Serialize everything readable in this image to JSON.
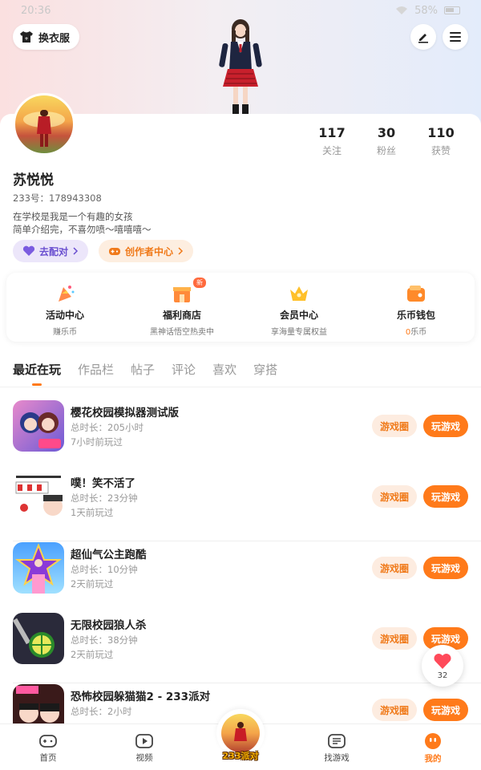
{
  "status_bar": {
    "time": "20:36",
    "battery": "58%"
  },
  "header": {
    "outfit_label": "换衣服"
  },
  "profile": {
    "name": "苏悦悦",
    "uid": "233号：178943308",
    "bio_line1": "在学校是我是一个有趣的女孩",
    "bio_line2": "简单介绍完，不喜勿喷～嘻嘻嘻～",
    "stats": [
      {
        "num": "117",
        "label": "关注"
      },
      {
        "num": "30",
        "label": "粉丝"
      },
      {
        "num": "110",
        "label": "获赞"
      }
    ],
    "pair_label": "去配对",
    "creator_label": "创作者中心"
  },
  "services": [
    {
      "title": "活动中心",
      "sub": "赚乐币",
      "icon": "party-icon"
    },
    {
      "title": "福利商店",
      "sub": "黑神话悟空热卖中",
      "icon": "shop-icon",
      "badge": "new"
    },
    {
      "title": "会员中心",
      "sub": "享海量专属权益",
      "icon": "crown-icon"
    },
    {
      "title": "乐币钱包",
      "sub_zero": "0",
      "sub": "乐币",
      "icon": "wallet-icon"
    }
  ],
  "tabs": [
    "最近在玩",
    "作品栏",
    "帖子",
    "评论",
    "喜欢",
    "穿搭"
  ],
  "games": [
    {
      "title": "樱花校园模拟器测试版",
      "duration": "总时长：205小时",
      "last": "7小时前玩过"
    },
    {
      "title": "噗！笑不活了",
      "duration": "总时长：23分钟",
      "last": "1天前玩过"
    },
    {
      "title": "超仙气公主跑酷",
      "duration": "总时长：10分钟",
      "last": "2天前玩过"
    },
    {
      "title": "无限校园狼人杀",
      "duration": "总时长：38分钟",
      "last": "2天前玩过"
    },
    {
      "title": "恐怖校园躲猫猫2 - 233派对",
      "duration": "总时长：2小时",
      "last": ""
    }
  ],
  "buttons": {
    "circle": "游戏圈",
    "play": "玩游戏"
  },
  "like_fab": {
    "count": "32"
  },
  "nav": {
    "home": "首页",
    "video": "视频",
    "center": "233派对",
    "find": "找游戏",
    "me": "我的"
  },
  "colors": {
    "accent": "#ff7a1a",
    "purple": "#6a4fd0"
  }
}
